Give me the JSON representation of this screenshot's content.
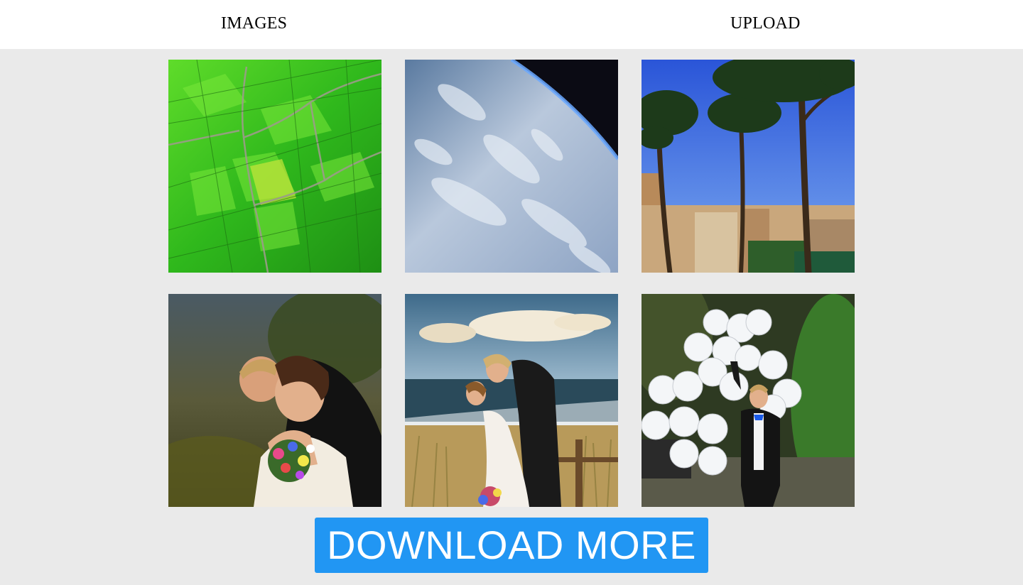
{
  "nav": {
    "images_label": "IMAGES",
    "upload_label": "UPLOAD"
  },
  "gallery": {
    "images": [
      {
        "subject": "aerial-green-fields"
      },
      {
        "subject": "earth-from-space"
      },
      {
        "subject": "umbrella-pines-rome"
      },
      {
        "subject": "wedding-couple-bouquet"
      },
      {
        "subject": "wedding-couple-beach-kiss"
      },
      {
        "subject": "groom-with-white-balloons"
      }
    ]
  },
  "download_button": {
    "label": "DOWNLOAD MORE",
    "color": "#2196f3"
  },
  "colors": {
    "page_background": "#eaeaea",
    "topbar_background": "#ffffff"
  }
}
